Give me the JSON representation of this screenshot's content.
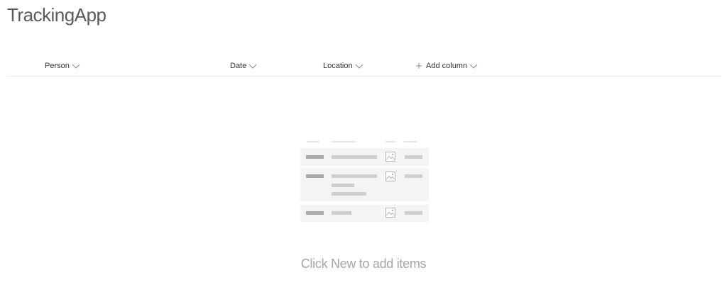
{
  "app": {
    "title": "TrackingApp"
  },
  "list": {
    "columns": [
      {
        "label": "Person",
        "icon": "chevron-down-icon"
      },
      {
        "label": "Date",
        "icon": "chevron-down-icon"
      },
      {
        "label": "Location",
        "icon": "chevron-down-icon"
      }
    ],
    "add_column": {
      "label": "Add column",
      "icon_leading": "plus-icon",
      "icon_trailing": "chevron-down-icon"
    },
    "empty_message": "Click New to add items"
  },
  "colors": {
    "title_text": "#5a5a5a",
    "empty_text": "#a6a6a6",
    "illustration_bg": "#f4f4f4",
    "divider": "#ececec"
  }
}
